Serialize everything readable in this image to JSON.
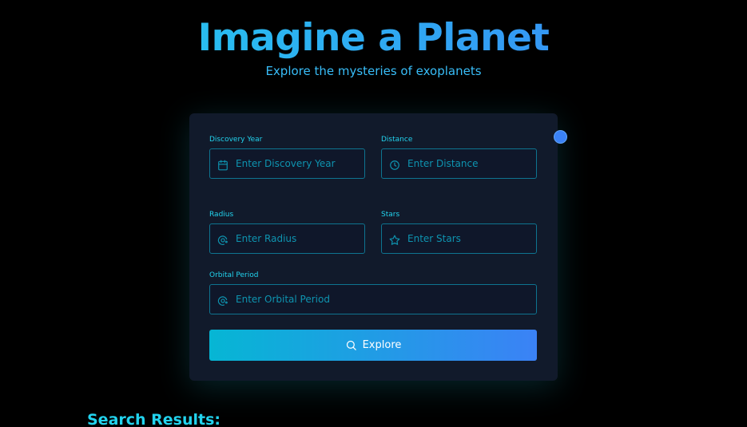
{
  "header": {
    "title": "Imagine a Planet",
    "subtitle": "Explore the mysteries of exoplanets"
  },
  "form": {
    "discovery_year": {
      "label": "Discovery Year",
      "placeholder": "Enter Discovery Year",
      "value": "",
      "icon": "calendar-icon"
    },
    "distance": {
      "label": "Distance",
      "placeholder": "Enter Distance",
      "value": "",
      "icon": "clock-icon"
    },
    "radius": {
      "label": "Radius",
      "placeholder": "Enter Radius",
      "value": "",
      "icon": "orbit-icon"
    },
    "stars": {
      "label": "Stars",
      "placeholder": "Enter Stars",
      "value": "",
      "icon": "star-icon"
    },
    "orbital_period": {
      "label": "Orbital Period",
      "placeholder": "Enter Orbital Period",
      "value": "",
      "icon": "orbit-icon"
    },
    "explore_button": {
      "label": "Explore",
      "icon": "search-icon"
    }
  },
  "results": {
    "title": "Search Results:"
  },
  "colors": {
    "background": "#000000",
    "card": "#111a2b",
    "accent_cyan": "#22d3ee",
    "accent_blue": "#3b82f6",
    "input_border": "#0e7490"
  }
}
